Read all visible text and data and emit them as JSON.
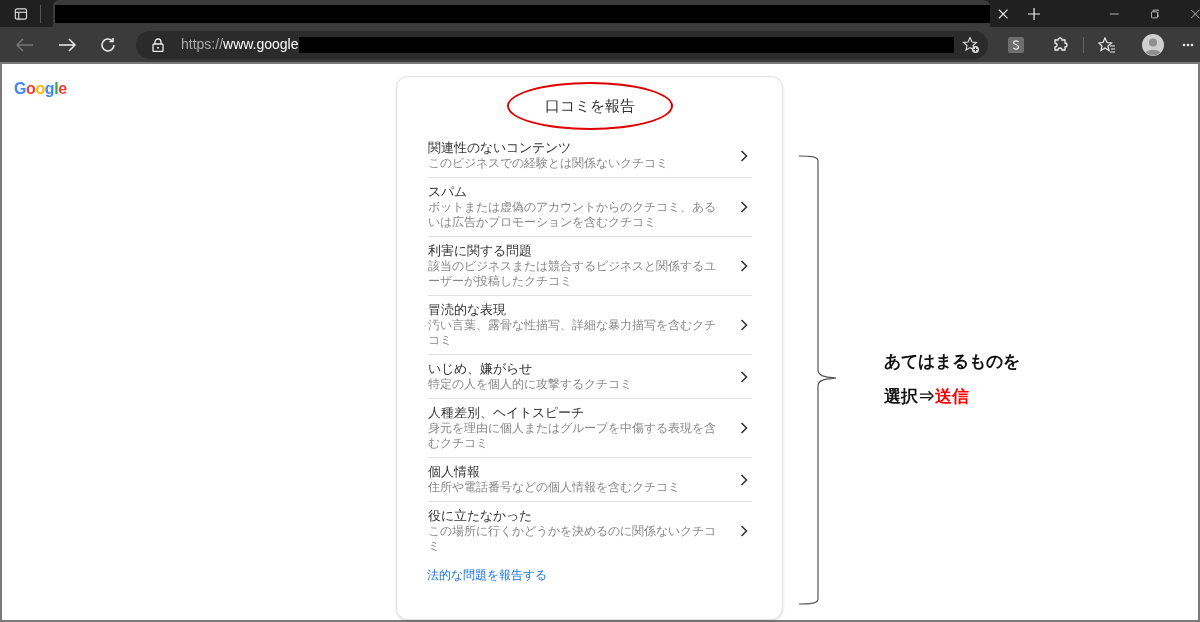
{
  "browser": {
    "url_scheme": "https://",
    "url_host": "www.google"
  },
  "page": {
    "logo": "Google"
  },
  "dialog": {
    "title": "口コミを報告",
    "options": [
      {
        "title": "関連性のないコンテンツ",
        "description": "このビジネスでの経験とは関係ないクチコミ"
      },
      {
        "title": "スパム",
        "description": "ボットまたは虚偽のアカウントからのクチコミ、あるいは広告かプロモーションを含むクチコミ"
      },
      {
        "title": "利害に関する問題",
        "description": "該当のビジネスまたは競合するビジネスと関係するユーザーが投稿したクチコミ"
      },
      {
        "title": "冒涜的な表現",
        "description": "汚い言葉、露骨な性描写、詳細な暴力描写を含むクチコミ"
      },
      {
        "title": "いじめ、嫌がらせ",
        "description": "特定の人を個人的に攻撃するクチコミ"
      },
      {
        "title": "人種差別、ヘイトスピーチ",
        "description": "身元を理由に個人またはグループを中傷する表現を含むクチコミ"
      },
      {
        "title": "個人情報",
        "description": "住所や電話番号などの個人情報を含むクチコミ"
      },
      {
        "title": "役に立たなかった",
        "description": "この場所に行くかどうかを決めるのに関係ないクチコミ"
      }
    ],
    "legal_link": "法的な問題を報告する"
  },
  "annotation": {
    "line_1": "あてはまるものを",
    "line_2_prefix": "選択⇒",
    "line_2_highlight": "送信"
  }
}
